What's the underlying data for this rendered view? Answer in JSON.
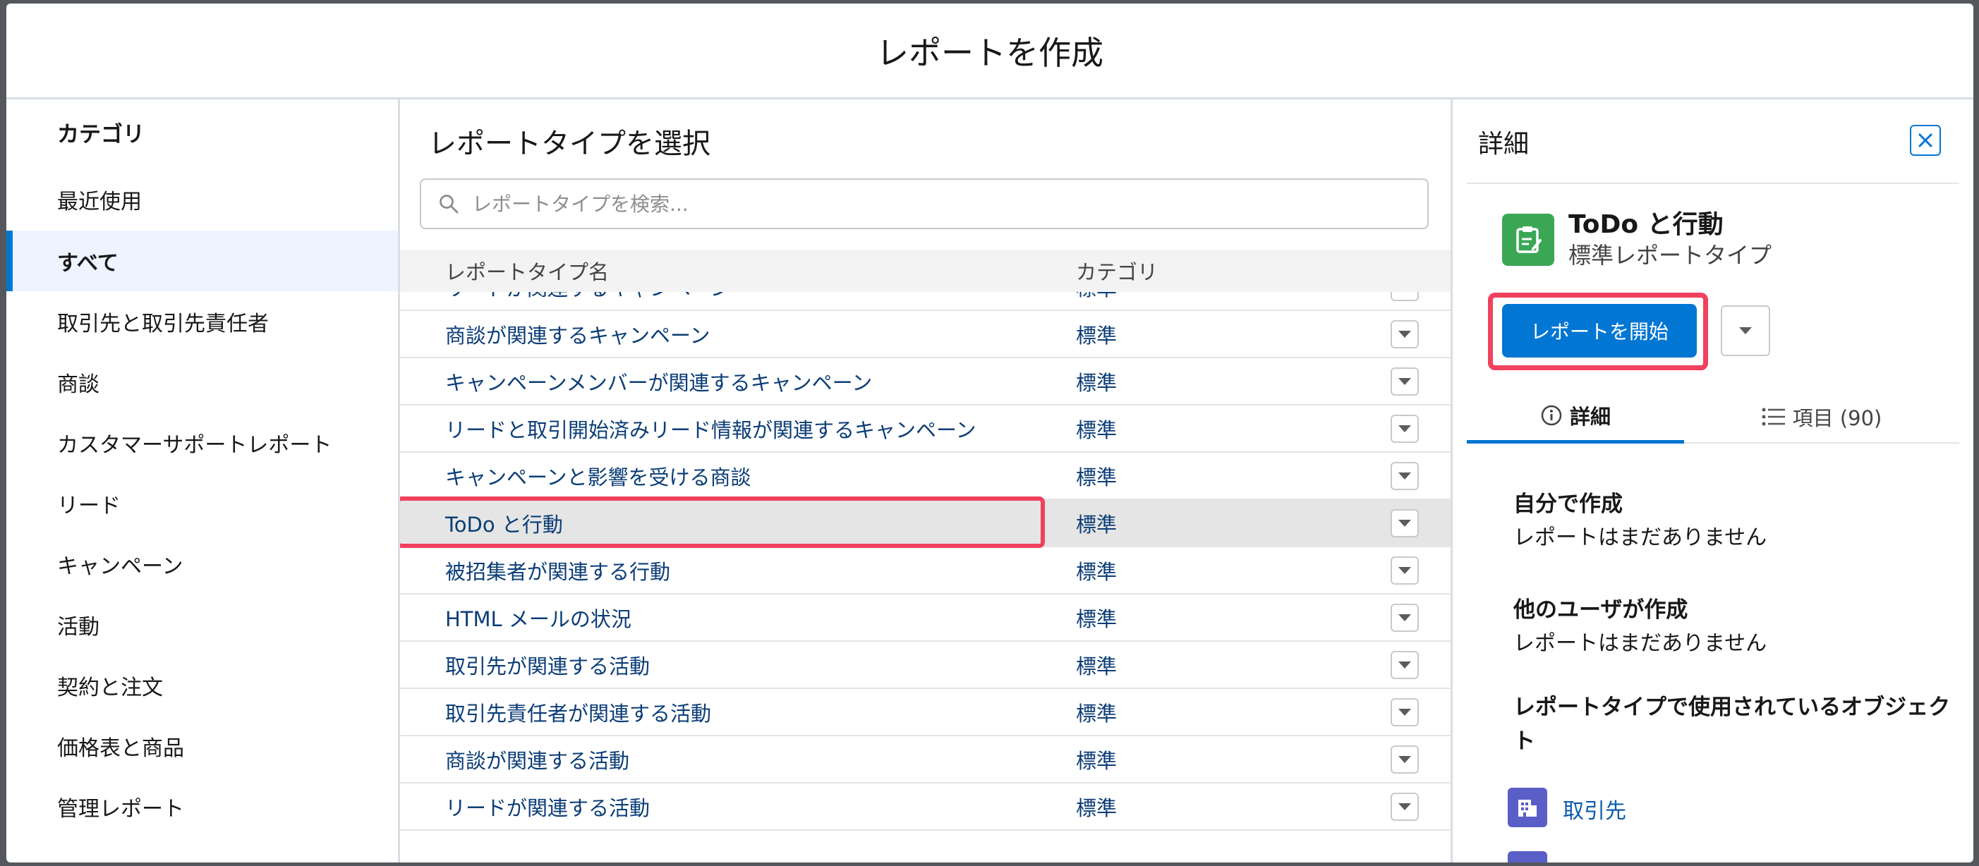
{
  "modal": {
    "title": "レポートを作成"
  },
  "categories": {
    "heading": "カテゴリ",
    "items": [
      {
        "label": "最近使用",
        "selected": false
      },
      {
        "label": "すべて",
        "selected": true
      },
      {
        "label": "取引先と取引先責任者",
        "selected": false
      },
      {
        "label": "商談",
        "selected": false
      },
      {
        "label": "カスタマーサポートレポート",
        "selected": false
      },
      {
        "label": "リード",
        "selected": false
      },
      {
        "label": "キャンペーン",
        "selected": false
      },
      {
        "label": "活動",
        "selected": false
      },
      {
        "label": "契約と注文",
        "selected": false
      },
      {
        "label": "価格表と商品",
        "selected": false
      },
      {
        "label": "管理レポート",
        "selected": false
      }
    ]
  },
  "report_types": {
    "title": "レポートタイプを選択",
    "search_placeholder": "レポートタイプを検索...",
    "columns": {
      "name": "レポートタイプ名",
      "category": "カテゴリ"
    },
    "rows": [
      {
        "name": "リードが関連するキャンペーン",
        "category": "標準"
      },
      {
        "name": "商談が関連するキャンペーン",
        "category": "標準"
      },
      {
        "name": "キャンペーンメンバーが関連するキャンペーン",
        "category": "標準"
      },
      {
        "name": "リードと取引開始済みリード情報が関連するキャンペーン",
        "category": "標準"
      },
      {
        "name": "キャンペーンと影響を受ける商談",
        "category": "標準"
      },
      {
        "name": "ToDo と行動",
        "category": "標準",
        "highlighted": true
      },
      {
        "name": "被招集者が関連する行動",
        "category": "標準"
      },
      {
        "name": "HTML メールの状況",
        "category": "標準"
      },
      {
        "name": "取引先が関連する活動",
        "category": "標準"
      },
      {
        "name": "取引先責任者が関連する活動",
        "category": "標準"
      },
      {
        "name": "商談が関連する活動",
        "category": "標準"
      },
      {
        "name": "リードが関連する活動",
        "category": "標準"
      }
    ]
  },
  "details": {
    "title": "詳細",
    "type_name": "ToDo と行動",
    "type_sub": "標準レポートタイプ",
    "start_button": "レポートを開始",
    "tabs": {
      "detail": "詳細",
      "fields": "項目 (90)"
    },
    "created_by_me": {
      "title": "自分で作成",
      "text": "レポートはまだありません"
    },
    "created_by_others": {
      "title": "他のユーザが作成",
      "text": "レポートはまだありません"
    },
    "objects_title": "レポートタイプで使用されているオブジェクト",
    "objects": [
      "取引先"
    ]
  },
  "colors": {
    "accent": "#0176d3",
    "highlight_outline": "#f0415e",
    "type_icon": "#3ba755"
  }
}
